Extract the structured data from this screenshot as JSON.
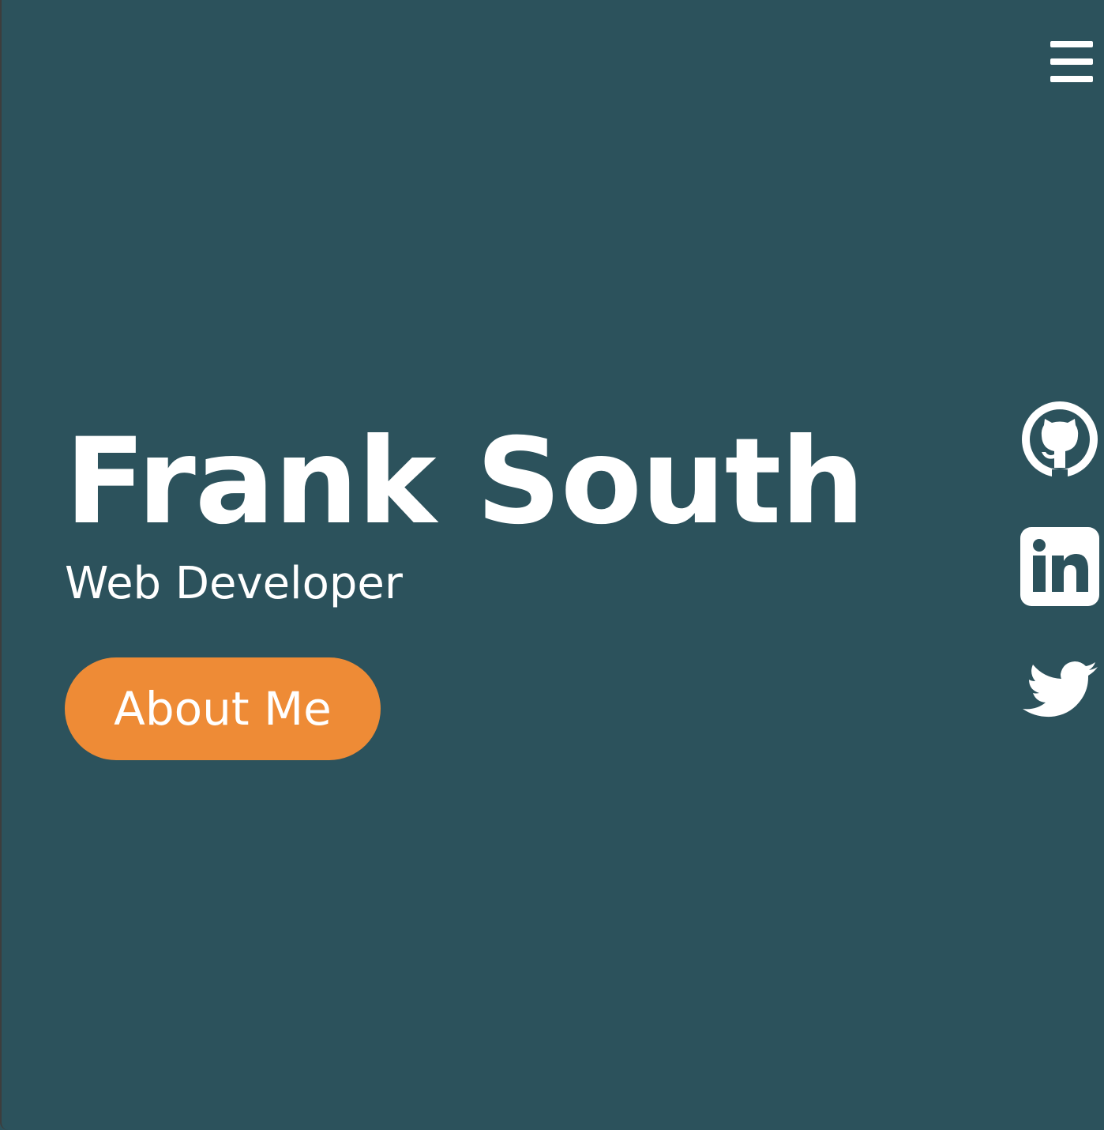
{
  "header": {
    "menu_icon": "hamburger-menu-icon"
  },
  "hero": {
    "name": "Frank South",
    "role": "Web Developer",
    "cta_label": "About Me"
  },
  "social": [
    {
      "icon": "github-icon"
    },
    {
      "icon": "linkedin-icon"
    },
    {
      "icon": "twitter-icon"
    }
  ],
  "colors": {
    "background": "#2c525c",
    "accent": "#ee8b36",
    "text": "#ffffff"
  }
}
